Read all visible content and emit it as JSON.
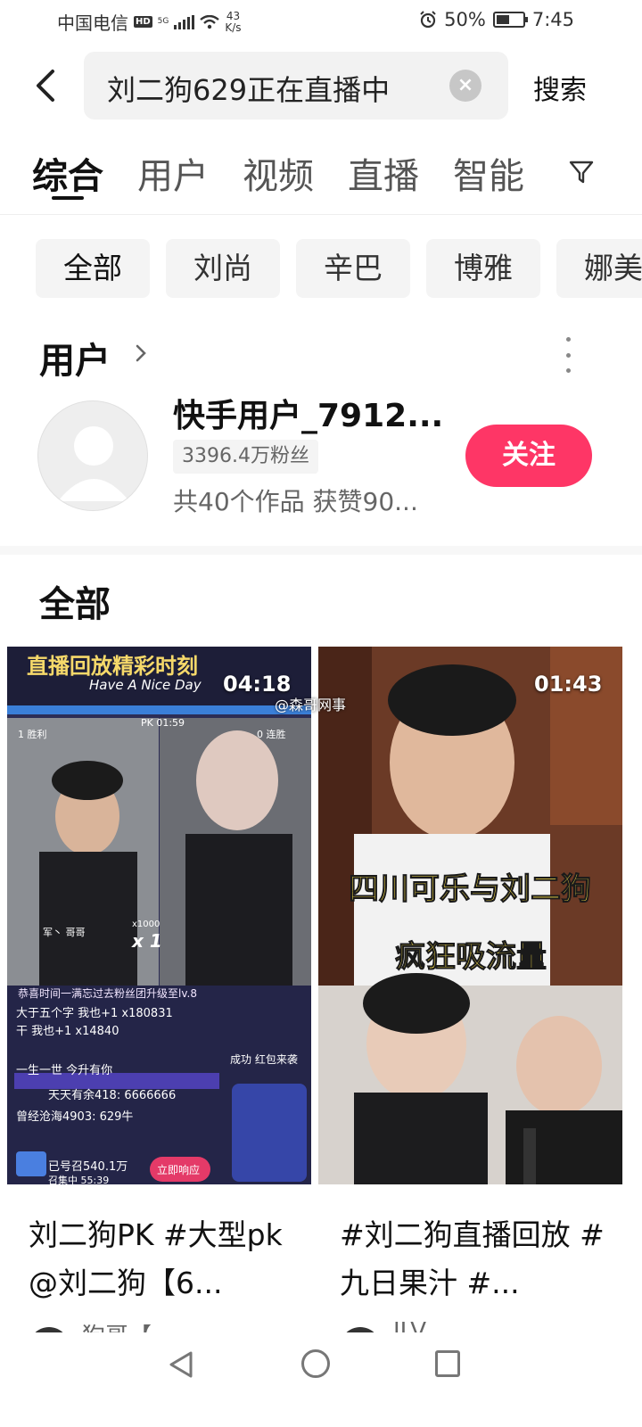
{
  "status_bar": {
    "carrier": "中国电信",
    "hd": "HD",
    "net": "5G",
    "speed_value": "43",
    "speed_unit": "K/s",
    "battery": "50%",
    "battery_level": 0.5,
    "time": "7:45"
  },
  "search": {
    "query": "刘二狗629正在直播中",
    "button_label": "搜索"
  },
  "tabs": [
    "综合",
    "用户",
    "视频",
    "直播",
    "智能"
  ],
  "chips": [
    "全部",
    "刘尚",
    "辛巴",
    "博雅",
    "娜美"
  ],
  "user_section": {
    "title": "用户",
    "user": {
      "name": "快手用户_7912...",
      "fans": "3396.4万粉丝",
      "works": "共40个作品 获赞90...",
      "follow_label": "关注"
    }
  },
  "all_section": {
    "title": "全部"
  },
  "watermark": "@森哥网事",
  "videos": [
    {
      "duration": "04:18",
      "title": "刘二狗PK #大型pk @刘二狗【6...",
      "author": "狗哥【",
      "overlay": {
        "banner": "直播回放精彩时刻",
        "banner_sub": "Have A Nice Day",
        "pk": "PK 01:59",
        "left_score": "1 胜利",
        "right_score": "0 连胜",
        "gift_line": "军丶 哥哥",
        "multiplier": "x 1",
        "multiplier_top": "x1000",
        "upgrade": "恭喜时间一满忘过去粉丝团升级至lv.8",
        "chat": [
          "大于五个字 我也+1 x180831",
          "干 我也+1 x14840",
          "一生一世 今升有你",
          "天天有余418: 6666666",
          "曾经沧海4903: 629牛"
        ],
        "red_pack": "成功 红包来袭",
        "summon": "已号召540.1万",
        "summon_sub": "召集中 55:39",
        "respond": "立即响应"
      }
    },
    {
      "duration": "01:43",
      "title": "#刘二狗直播回放 #九日果汁 #...",
      "author": "JLV",
      "overlay": {
        "caption1": "四川可乐与刘二狗",
        "caption2": "疯狂吸流量"
      }
    }
  ],
  "colors": {
    "accent": "#fe3666",
    "caption_bg": "#fbe14a",
    "caption_text": "#1a1a1a"
  },
  "icons": [
    "back-arrow-icon",
    "clear-icon",
    "filter-icon",
    "chevron-right-icon",
    "more-icon",
    "nav-back-icon",
    "nav-home-icon",
    "nav-recent-icon"
  ]
}
